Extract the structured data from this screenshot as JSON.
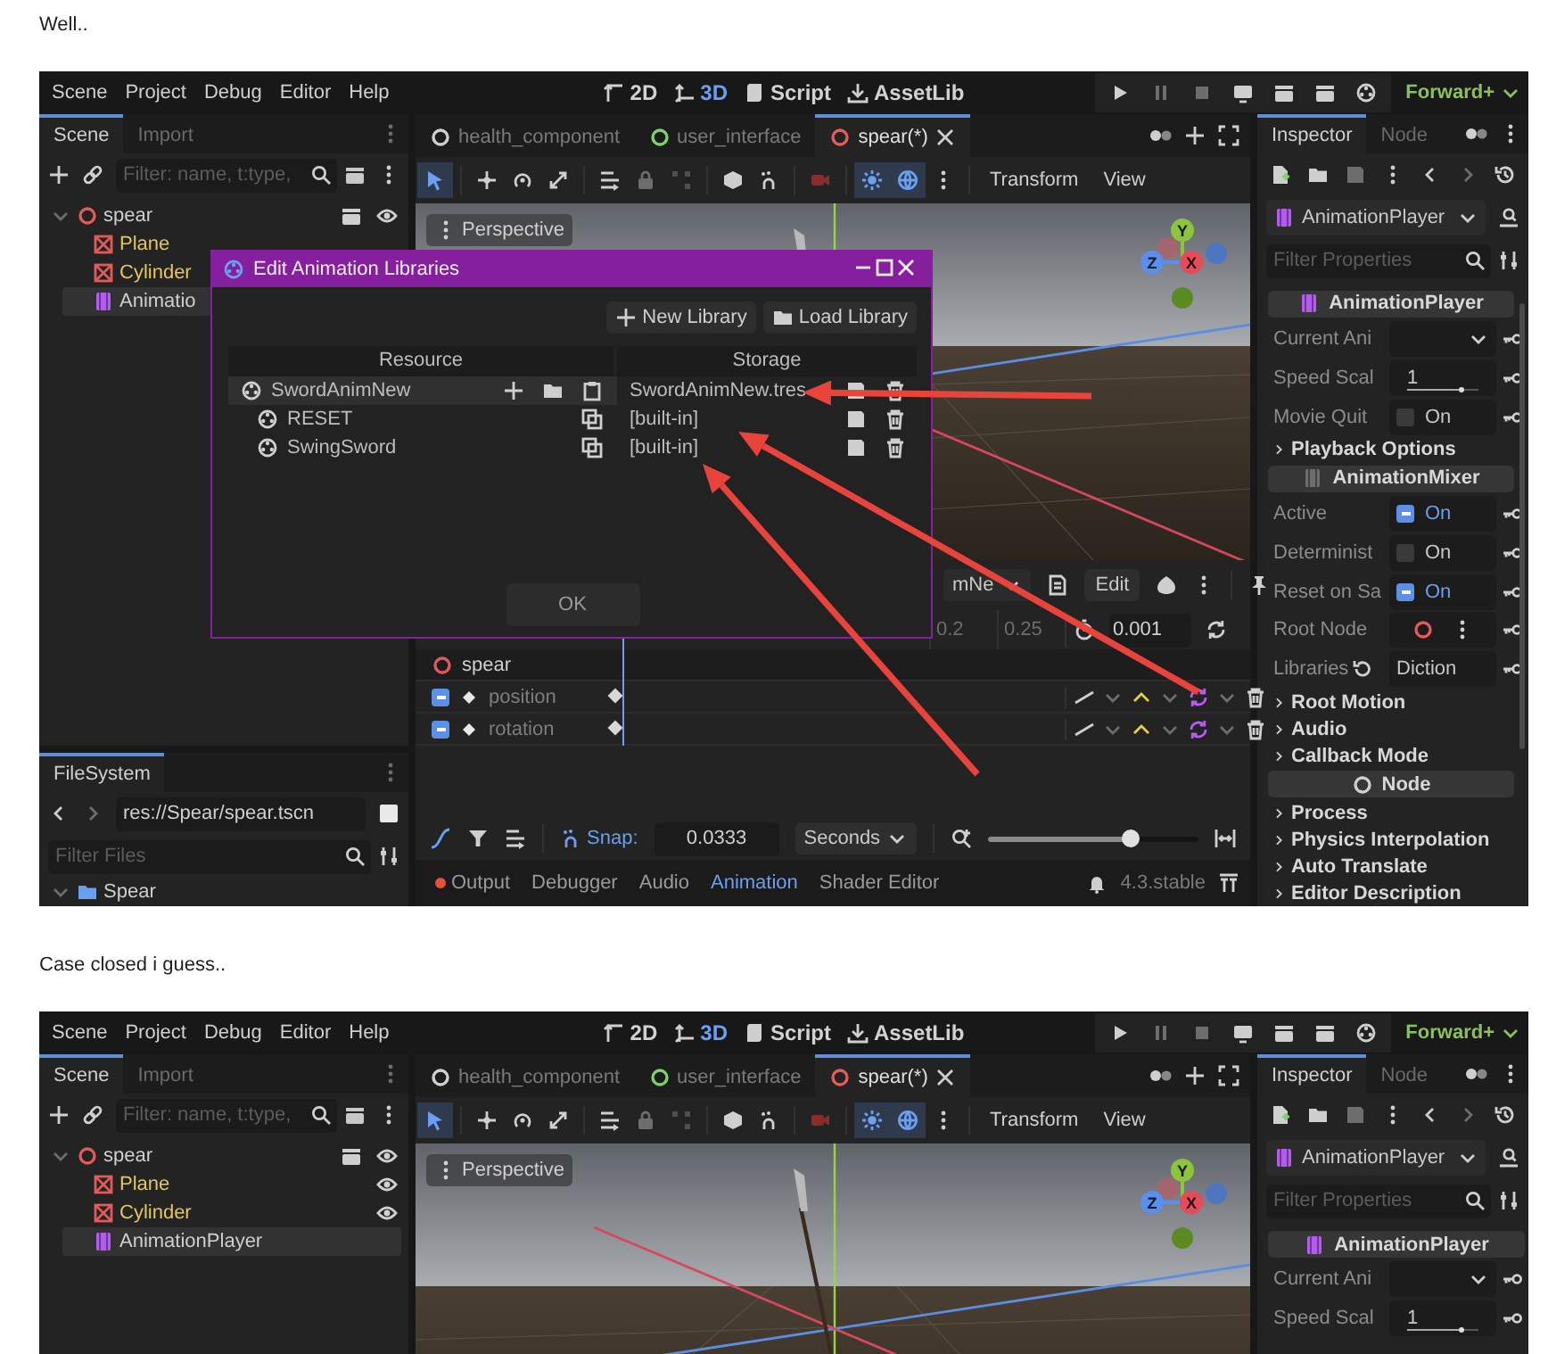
{
  "posts": [
    {
      "kind": "paragraph",
      "text": "Well.."
    },
    {
      "kind": "screenshot",
      "marked_up": true,
      "editor": {
        "menu": [
          "Scene",
          "Project",
          "Debug",
          "Editor",
          "Help"
        ],
        "workspaces": [
          {
            "label": "2D",
            "kind": "canvas",
            "selected": false
          },
          {
            "label": "3D",
            "kind": "spatial",
            "selected": true
          },
          {
            "label": "Script",
            "kind": "script",
            "selected": false
          },
          {
            "label": "AssetLib",
            "kind": "assetlib",
            "selected": false
          }
        ],
        "renderer": "Forward+",
        "scene_dock": {
          "tabs": [
            {
              "label": "Scene",
              "selected": true
            },
            {
              "label": "Import",
              "selected": false
            }
          ],
          "filter_placeholder": "Filter: name, t:type,",
          "tree": [
            {
              "label": "spear",
              "kind": "root",
              "expanded": true,
              "selected": false,
              "visible": true,
              "children": [
                {
                  "label": "Plane",
                  "kind": "mesh",
                  "selected": false
                },
                {
                  "label": "Cylinder",
                  "kind": "mesh",
                  "selected": false
                },
                {
                  "label": "Animatio",
                  "kind": "anim",
                  "selected": true
                }
              ]
            }
          ]
        },
        "filesystem": {
          "tabs": [
            {
              "label": "FileSystem",
              "selected": true
            }
          ],
          "path": "res://Spear/spear.tscn",
          "filter_placeholder": "Filter Files",
          "tree": [
            {
              "label": "Spear",
              "kind": "folder",
              "expanded": true,
              "selected": false
            }
          ]
        },
        "scene_tabs": [
          {
            "label": "health_component",
            "color": "#d0d0d0",
            "selected": false
          },
          {
            "label": "user_interface",
            "color": "#7bd36c",
            "selected": false
          },
          {
            "label": "spear(*)",
            "color": "#e65a5a",
            "selected": true
          }
        ],
        "tools": [
          {
            "kind": "select",
            "on": true
          },
          {
            "kind": "move",
            "on": false
          },
          {
            "kind": "rotate",
            "on": false
          },
          {
            "kind": "scale",
            "on": false
          },
          {
            "kind": "list",
            "on": false
          },
          {
            "kind": "lock",
            "on": false
          },
          {
            "kind": "group",
            "on": false
          },
          {
            "kind": "cube",
            "on": false
          },
          {
            "kind": "snap",
            "on": false
          },
          {
            "kind": "camera",
            "on": false
          },
          {
            "kind": "sun",
            "on": true
          },
          {
            "kind": "globe",
            "on": true
          },
          {
            "kind": "more",
            "on": false
          }
        ],
        "viewport_menus": [
          "Transform",
          "View"
        ],
        "viewport": {
          "view_menu": "Perspective",
          "gizmo": [
            {
              "label": "Y",
              "color": "#8cc43c"
            },
            {
              "label": "Z",
              "color": "#5a8ff0"
            },
            {
              "label": "X",
              "color": "#e84a5a"
            }
          ]
        },
        "animation_panel": {
          "animation": "mNe",
          "edit_button": "Edit",
          "ticks": [
            "0.2",
            "0.25"
          ],
          "step": "0.001",
          "tracks": [
            {
              "label": "spear",
              "kind": "node"
            },
            {
              "label": "position",
              "kind": "property",
              "enabled": true
            },
            {
              "label": "rotation",
              "kind": "property",
              "enabled": true
            }
          ],
          "snap_label": "Snap:",
          "snap": "0.0333",
          "snap_unit": "Seconds",
          "zoom": {
            "level": 0.68
          }
        },
        "bottom_tabs": [
          {
            "label": "Output",
            "alert": true,
            "selected": false
          },
          {
            "label": "Debugger",
            "alert": false,
            "selected": false
          },
          {
            "label": "Audio",
            "alert": false,
            "selected": false
          },
          {
            "label": "Animation",
            "alert": false,
            "selected": true
          },
          {
            "label": "Shader Editor",
            "alert": false,
            "selected": false
          }
        ],
        "version": "4.3.stable",
        "inspector": {
          "tabs": [
            {
              "label": "Inspector",
              "selected": true
            },
            {
              "label": "Node",
              "selected": false
            }
          ],
          "object": "AnimationPlayer",
          "filter_placeholder": "Filter Properties",
          "properties": [
            {
              "kind": "section",
              "label": "AnimationPlayer"
            },
            {
              "kind": "dropdown",
              "label": "Current Ani"
            },
            {
              "kind": "number",
              "label": "Speed Scal",
              "value": "1",
              "level": 0.75
            },
            {
              "kind": "checkbox",
              "label": "Movie Quit",
              "value": "On",
              "checked": false
            },
            {
              "kind": "group",
              "label": "Playback Options",
              "expanded": false
            },
            {
              "kind": "basesection",
              "label": "AnimationMixer"
            },
            {
              "kind": "checkbox",
              "label": "Active",
              "value": "On",
              "checked": true
            },
            {
              "kind": "checkbox",
              "label": "Determinist",
              "value": "On",
              "checked": false
            },
            {
              "kind": "checkbox",
              "label": "Reset on Sa",
              "value": "On",
              "checked": true
            },
            {
              "kind": "node",
              "label": "Root Node"
            },
            {
              "kind": "dictionary",
              "label": "Libraries",
              "value": "Diction",
              "revertable": true
            },
            {
              "kind": "group",
              "label": "Root Motion",
              "expanded": false
            },
            {
              "kind": "group",
              "label": "Audio",
              "expanded": false
            },
            {
              "kind": "group",
              "label": "Callback Mode",
              "expanded": false
            },
            {
              "kind": "nodesection",
              "label": "Node"
            },
            {
              "kind": "group",
              "label": "Process",
              "expanded": false
            },
            {
              "kind": "group",
              "label": "Physics Interpolation",
              "expanded": false
            },
            {
              "kind": "group",
              "label": "Auto Translate",
              "expanded": false
            },
            {
              "kind": "group",
              "label": "Editor Description",
              "expanded": false
            }
          ]
        },
        "dialog": {
          "title": "Edit Animation Libraries",
          "buttons": [
            {
              "label": "New Library",
              "kind": "new"
            },
            {
              "label": "Load Library",
              "kind": "load"
            }
          ],
          "columns": [
            "Resource",
            "Storage"
          ],
          "rows": [
            {
              "kind": "library",
              "name": "SwordAnimNew",
              "storage": "SwordAnimNew.tres",
              "selected": true
            },
            {
              "kind": "animation",
              "name": "RESET",
              "storage": "[built-in]",
              "selected": false
            },
            {
              "kind": "animation",
              "name": "SwingSword",
              "storage": "[built-in]",
              "selected": false
            }
          ],
          "ok": "OK"
        }
      }
    },
    {
      "kind": "paragraph",
      "text": "Case closed i guess.."
    },
    {
      "kind": "screenshot",
      "marked_up": false,
      "editor": {
        "menu": [
          "Scene",
          "Project",
          "Debug",
          "Editor",
          "Help"
        ],
        "workspaces": [
          {
            "label": "2D",
            "kind": "canvas",
            "selected": false
          },
          {
            "label": "3D",
            "kind": "spatial",
            "selected": true
          },
          {
            "label": "Script",
            "kind": "script",
            "selected": false
          },
          {
            "label": "AssetLib",
            "kind": "assetlib",
            "selected": false
          }
        ],
        "renderer": "Forward+",
        "scene_dock": {
          "tabs": [
            {
              "label": "Scene",
              "selected": true
            },
            {
              "label": "Import",
              "selected": false
            }
          ],
          "filter_placeholder": "Filter: name, t:type,",
          "tree": [
            {
              "label": "spear",
              "kind": "root",
              "expanded": true,
              "selected": false,
              "visible": true,
              "children": [
                {
                  "label": "Plane",
                  "kind": "mesh",
                  "selected": false,
                  "visible": true
                },
                {
                  "label": "Cylinder",
                  "kind": "mesh",
                  "selected": false,
                  "visible": true
                },
                {
                  "label": "AnimationPlayer",
                  "kind": "anim",
                  "selected": true
                }
              ]
            }
          ]
        },
        "scene_tabs": [
          {
            "label": "health_component",
            "color": "#d0d0d0",
            "selected": false
          },
          {
            "label": "user_interface",
            "color": "#7bd36c",
            "selected": false
          },
          {
            "label": "spear(*)",
            "color": "#e65a5a",
            "selected": true
          }
        ],
        "tools": [
          {
            "kind": "select",
            "on": true
          },
          {
            "kind": "move",
            "on": false
          },
          {
            "kind": "rotate",
            "on": false
          },
          {
            "kind": "scale",
            "on": false
          },
          {
            "kind": "list",
            "on": false
          },
          {
            "kind": "lock",
            "on": false
          },
          {
            "kind": "group",
            "on": false
          },
          {
            "kind": "cube",
            "on": false
          },
          {
            "kind": "snap",
            "on": false
          },
          {
            "kind": "camera",
            "on": false
          },
          {
            "kind": "sun",
            "on": true
          },
          {
            "kind": "globe",
            "on": true
          },
          {
            "kind": "more",
            "on": false
          }
        ],
        "viewport_menus": [
          "Transform",
          "View"
        ],
        "viewport": {
          "view_menu": "Perspective",
          "gizmo": [
            {
              "label": "Y",
              "color": "#8cc43c"
            },
            {
              "label": "Z",
              "color": "#5a8ff0"
            },
            {
              "label": "X",
              "color": "#e84a5a"
            }
          ]
        },
        "inspector": {
          "tabs": [
            {
              "label": "Inspector",
              "selected": true
            },
            {
              "label": "Node",
              "selected": false
            }
          ],
          "object": "AnimationPlayer",
          "filter_placeholder": "Filter Properties",
          "properties": [
            {
              "kind": "section",
              "label": "AnimationPlayer"
            },
            {
              "kind": "dropdown",
              "label": "Current Ani"
            },
            {
              "kind": "number",
              "label": "Speed Scal",
              "value": "1",
              "level": 0.75
            }
          ]
        }
      }
    }
  ]
}
